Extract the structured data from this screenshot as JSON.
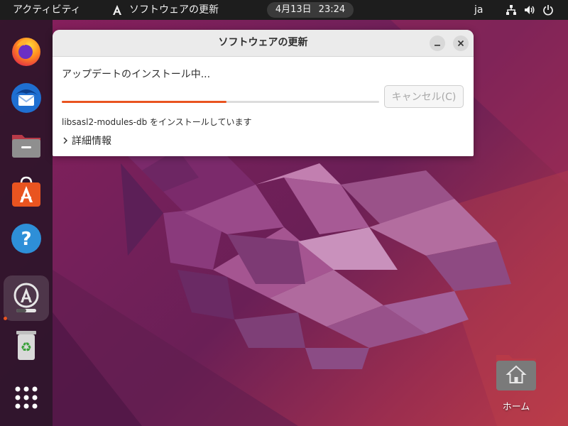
{
  "topbar": {
    "activities_label": "アクティビティ",
    "app_menu_label": "ソフトウェアの更新",
    "app_menu_icon": "software-updater-icon",
    "clock_date": "4月13日",
    "clock_time": "23:24",
    "input_language": "ja",
    "tray_icons": [
      "network-icon",
      "volume-icon",
      "power-icon"
    ]
  },
  "dock": {
    "items": [
      {
        "name": "firefox",
        "icon": "firefox-icon"
      },
      {
        "name": "thunderbird",
        "icon": "thunderbird-icon"
      },
      {
        "name": "files",
        "icon": "files-icon"
      },
      {
        "name": "app-center",
        "icon": "app-center-icon"
      },
      {
        "name": "help",
        "icon": "help-icon"
      },
      {
        "name": "software-updater",
        "icon": "software-updater-icon",
        "active": true
      },
      {
        "name": "trash",
        "icon": "trash-icon"
      },
      {
        "name": "show-apps",
        "icon": "app-grid-icon"
      }
    ]
  },
  "dialog": {
    "title": "ソフトウェアの更新",
    "progress_label": "アップデートのインストール中...",
    "progress_fraction": 0.52,
    "cancel_label": "キャンセル(C)",
    "status_text": "libsasl2-modules-db をインストールしています",
    "details_label": "詳細情報"
  },
  "desktop": {
    "home_label": "ホーム"
  },
  "colors": {
    "accent": "#e95420",
    "topbar_bg": "#1d1d1d",
    "dock_bg": "#2a1a2a"
  }
}
